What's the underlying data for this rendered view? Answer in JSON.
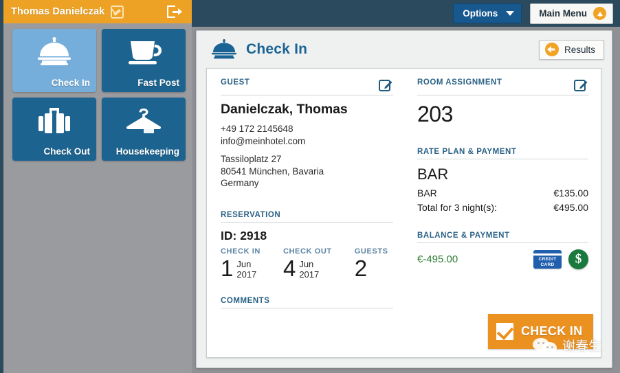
{
  "userbar": {
    "user_name": "Thomas Danielczak",
    "status_icon": "no-signal-icon",
    "logout_icon": "logout-icon"
  },
  "topbar": {
    "options_label": "Options",
    "options_icon": "chevron-down-icon",
    "main_menu_label": "Main Menu",
    "main_menu_icon": "up-arrow-circle-icon"
  },
  "sidebar": {
    "tiles": [
      {
        "label": "Check In",
        "icon": "service-bell-icon",
        "active": true
      },
      {
        "label": "Fast Post",
        "icon": "coffee-cup-icon",
        "active": false
      },
      {
        "label": "Check Out",
        "icon": "suitcase-icon",
        "active": false
      },
      {
        "label": "Housekeeping",
        "icon": "hanger-icon",
        "active": false
      }
    ]
  },
  "content": {
    "title": "Check In",
    "title_icon": "service-bell-icon",
    "results_label": "Results",
    "results_icon": "back-arrow-circle-icon"
  },
  "guest": {
    "section_title": "GUEST",
    "edit_icon": "edit-pencil-icon",
    "name": "Danielczak, Thomas",
    "phone": "+49 172 2145648",
    "email": "info@meinhotel.com",
    "address_line1": "Tassiloplatz 27",
    "address_line2": "80541 München, Bavaria",
    "address_line3": "Germany"
  },
  "reservation": {
    "section_title": "RESERVATION",
    "id": "ID: 2918",
    "check_in_label": "CHECK IN",
    "check_in_day": "1",
    "check_in_month": "Jun",
    "check_in_year": "2017",
    "check_out_label": "CHECK OUT",
    "check_out_day": "4",
    "check_out_month": "Jun",
    "check_out_year": "2017",
    "guests_label": "GUESTS",
    "guests_count": "2"
  },
  "comments": {
    "section_title": "COMMENTS",
    "text": ""
  },
  "room_assignment": {
    "section_title": "ROOM ASSIGNMENT",
    "edit_icon": "edit-pencil-icon",
    "room_number": "203"
  },
  "rate_plan": {
    "section_title": "RATE PLAN & PAYMENT",
    "plan_name": "BAR",
    "rate_label": "BAR",
    "rate_amount": "€135.00",
    "total_label": "Total for 3 night(s):",
    "total_amount": "€495.00"
  },
  "balance": {
    "section_title": "BALANCE & PAYMENT",
    "amount": "€-495.00",
    "amount_color": "#2e7d32",
    "credit_card_icon_line1": "CREDIT",
    "credit_card_icon_line2": "CARD",
    "cash_icon_symbol": "$"
  },
  "action": {
    "checkin_label": "CHECK IN",
    "checkin_icon": "checkbox-checked-icon"
  },
  "watermark": {
    "text": "谢春生",
    "icon": "wechat-icon"
  },
  "colors": {
    "orange": "#eda226",
    "dark_blue": "#2c4a5e",
    "tile_blue": "#1c6390",
    "tile_active_blue": "#76aedb",
    "accent_button": "#17588f",
    "checkin_orange": "#eb9120",
    "balance_green": "#2e7d32"
  }
}
